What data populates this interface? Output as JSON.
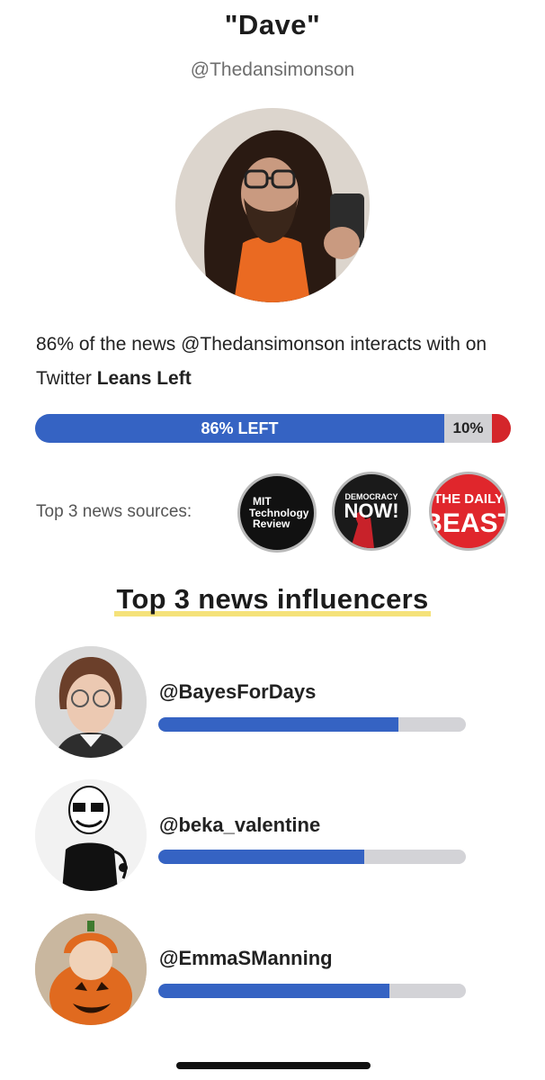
{
  "profile": {
    "name": "\"Dave\"",
    "handle": "@Thedansimonson",
    "summary_prefix": "86% of the news @Thedansimonson interacts with on Twitter ",
    "summary_strong": "Leans Left"
  },
  "lean": {
    "left_label": "86% LEFT",
    "left_value": 0.86,
    "right_label": "10%",
    "right_value": 0.1
  },
  "sources": {
    "label": "Top 3 news sources:",
    "items": [
      {
        "name": "MIT Technology Review",
        "lines": [
          "MIT",
          "Technology",
          "Review"
        ]
      },
      {
        "name": "Democracy Now!",
        "top": "DEMOCRACY",
        "main": "NOW!"
      },
      {
        "name": "The Daily Beast",
        "top": "THE DAILY",
        "main": "BEAST"
      }
    ]
  },
  "influencers": {
    "title": "Top 3 news influencers",
    "items": [
      {
        "handle": "@BayesForDays",
        "score": 0.78
      },
      {
        "handle": "@beka_valentine",
        "score": 0.67
      },
      {
        "handle": "@EmmaSManning",
        "score": 0.75
      }
    ]
  },
  "colors": {
    "left_blue": "#3563c3",
    "right_gray": "#d1d1d4",
    "right_red": "#d4262b",
    "highlight": "#f5e27a"
  }
}
